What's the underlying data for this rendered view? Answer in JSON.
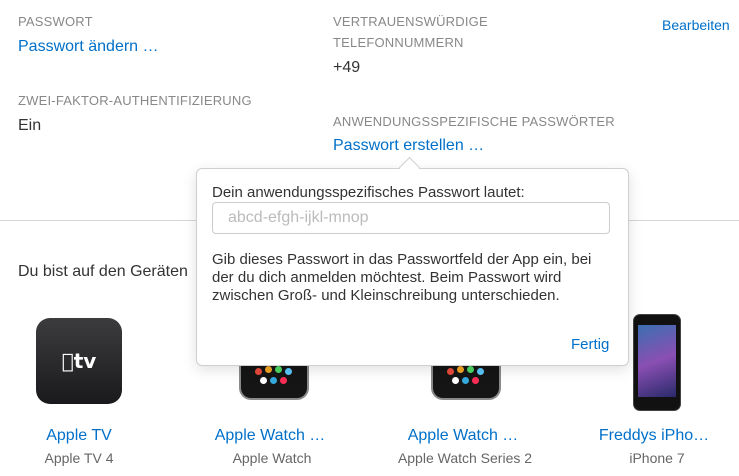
{
  "security": {
    "password_label": "PASSWORT",
    "password_link": "Passwort ändern …",
    "trusted_label_line1": "VERTRAUENSWÜRDIGE",
    "trusted_label_line2": "TELEFONNUMMERN",
    "trusted_value": "+49",
    "edit_button": "Bearbeiten",
    "twofactor_label": "ZWEI-FAKTOR-AUTHENTIFIZIERUNG",
    "twofactor_value": "Ein",
    "apppw_label": "ANWENDUNGSSPEZIFISCHE PASSWÖRTER",
    "apppw_link": "Passwort erstellen …"
  },
  "devices": {
    "intro": "Du bist auf den Geräten",
    "items": [
      {
        "name": "Apple TV",
        "model": "Apple TV 4",
        "icon": "apple-tv-icon"
      },
      {
        "name": "Apple Watch …",
        "model": "Apple Watch",
        "icon": "apple-watch-icon"
      },
      {
        "name": "Apple Watch …",
        "model": "Apple Watch Series 2",
        "icon": "apple-watch-icon"
      },
      {
        "name": "Freddys iPho…",
        "model": "iPhone 7",
        "icon": "iphone-icon"
      }
    ]
  },
  "popover": {
    "title": "Dein anwendungsspezifisches Passwort lautet:",
    "password_placeholder": "abcd-efgh-ijkl-mnop",
    "hint": "Gib dieses Passwort in das Passwortfeld der App ein, bei der du dich anmelden möchtest. Beim Passwort wird zwischen Groß- und Kleinschreibung unterschieden.",
    "done_button": "Fertig"
  },
  "colors": {
    "link": "#0070c9",
    "label": "#888888",
    "text": "#333333"
  }
}
